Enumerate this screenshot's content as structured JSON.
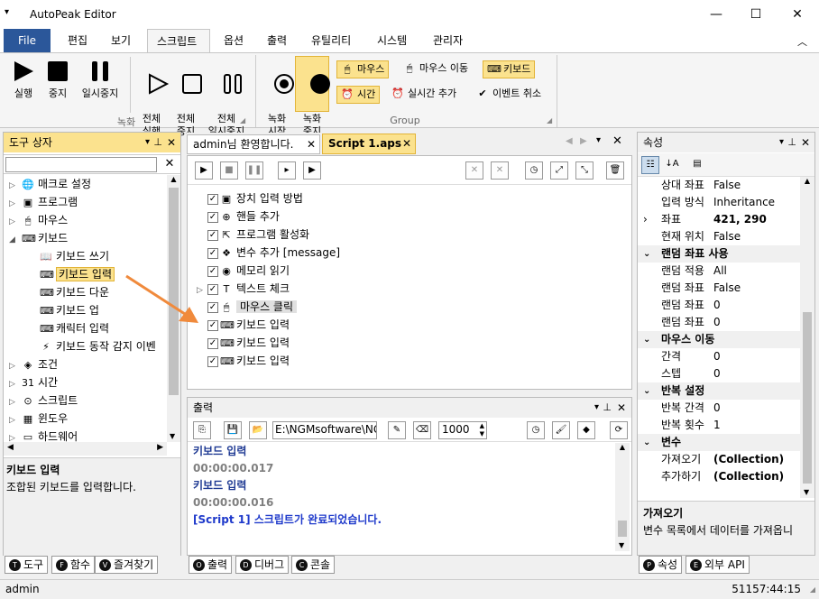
{
  "window": {
    "title": "AutoPeak Editor"
  },
  "ribbon_tabs": [
    "File",
    "편집",
    "보기",
    "스크립트",
    "옵션",
    "출력",
    "유틸리티",
    "시스템",
    "관리자"
  ],
  "record_group": {
    "label": "녹화",
    "buttons": [
      "실행",
      "중지",
      "일시중지",
      "전체\n실행",
      "전체\n중지",
      "전체\n일시중지"
    ]
  },
  "group2": {
    "label": "Group",
    "record_start": "녹화\n시작",
    "record_stop": "녹화\n중지",
    "mouse": "마우스",
    "mouse_move": "마우스 이동",
    "keyboard": "키보드",
    "time": "시간",
    "realtime_add": "실시간 추가",
    "event_cancel": "이벤트 취소"
  },
  "toolbox": {
    "title": "도구 상자",
    "items": [
      {
        "label": "매크로 설정",
        "level": 0,
        "arrow": "▷",
        "icon": "🌐"
      },
      {
        "label": "프로그램",
        "level": 0,
        "arrow": "▷",
        "icon": "▣"
      },
      {
        "label": "마우스",
        "level": 0,
        "arrow": "▷",
        "icon": "🖱"
      },
      {
        "label": "키보드",
        "level": 0,
        "arrow": "◢",
        "icon": "⌨"
      },
      {
        "label": "키보드 쓰기",
        "level": 1,
        "icon": "📖"
      },
      {
        "label": "키보드 입력",
        "level": 1,
        "icon": "⌨",
        "selected": true
      },
      {
        "label": "키보드 다운",
        "level": 1,
        "icon": "⌨"
      },
      {
        "label": "키보드 업",
        "level": 1,
        "icon": "⌨"
      },
      {
        "label": "캐릭터 입력",
        "level": 1,
        "icon": "⌨"
      },
      {
        "label": "키보드 동작 감지 이벤",
        "level": 1,
        "icon": "⚡"
      },
      {
        "label": "조건",
        "level": 0,
        "arrow": "▷",
        "icon": "◈"
      },
      {
        "label": "시간",
        "level": 0,
        "arrow": "▷",
        "icon": "31"
      },
      {
        "label": "스크립트",
        "level": 0,
        "arrow": "▷",
        "icon": "⊙"
      },
      {
        "label": "윈도우",
        "level": 0,
        "arrow": "▷",
        "icon": "▦"
      },
      {
        "label": "하드웨어",
        "level": 0,
        "arrow": "▷",
        "icon": "▭"
      }
    ],
    "desc_title": "키보드 입력",
    "desc_text": "조합된 키보드를 입력합니다."
  },
  "left_tabs": [
    "도구",
    "함수",
    "즐겨찾기"
  ],
  "doc_tabs": [
    "admin님 환영합니다.",
    "Script 1.aps"
  ],
  "script_items": [
    {
      "label": "장치 입력 방법",
      "icon": "▣"
    },
    {
      "label": "핸들 추가",
      "icon": "⊕"
    },
    {
      "label": "프로그램 활성화",
      "icon": "⇱"
    },
    {
      "label": "변수 추가 [message]",
      "icon": "❖"
    },
    {
      "label": "메모리 읽기",
      "icon": "◉"
    },
    {
      "label": "텍스트 체크",
      "icon": "T",
      "arrow": "▷"
    },
    {
      "label": "마우스 클릭",
      "icon": "🖱",
      "selected": true
    },
    {
      "label": "키보드 입력",
      "icon": "⌨"
    },
    {
      "label": "키보드 입력",
      "icon": "⌨"
    },
    {
      "label": "키보드 입력",
      "icon": "⌨"
    }
  ],
  "output": {
    "title": "출력",
    "path": "E:\\NGMsoftware\\NG",
    "number": "1000",
    "lines": [
      {
        "text": "키보드 입력",
        "color": "#1f3a93",
        "bold": true
      },
      {
        "text": "00:00:00.017",
        "color": "#808080",
        "bold": true
      },
      {
        "text": "키보드 입력",
        "color": "#1f3a93",
        "bold": true
      },
      {
        "text": "00:00:00.016",
        "color": "#808080",
        "bold": true
      },
      {
        "text": "[Script 1] 스크립트가 완료되었습니다.",
        "color": "#1f3acb",
        "bold": true
      }
    ]
  },
  "bottom_tabs": [
    "출력",
    "디버그",
    "콘솔"
  ],
  "properties": {
    "title": "속성",
    "rows": [
      {
        "k": "상대 좌표",
        "v": "False"
      },
      {
        "k": "입력 방식",
        "v": "Inheritance"
      },
      {
        "k": "좌표",
        "v": "421, 290",
        "bold": true,
        "arrow": "›"
      },
      {
        "k": "현재 위치",
        "v": "False"
      },
      {
        "cat": "랜덤 좌표 사용"
      },
      {
        "k": "랜덤 적용",
        "v": "All"
      },
      {
        "k": "랜덤 좌표",
        "v": "False"
      },
      {
        "k": "랜덤 좌표",
        "v": "0"
      },
      {
        "k": "랜덤 좌표",
        "v": "0"
      },
      {
        "cat": "마우스 이동"
      },
      {
        "k": "간격",
        "v": "0"
      },
      {
        "k": "스텝",
        "v": "0"
      },
      {
        "cat": "반복 설정"
      },
      {
        "k": "반복 간격",
        "v": "0"
      },
      {
        "k": "반복 횟수",
        "v": "1"
      },
      {
        "cat": "변수"
      },
      {
        "k": "가져오기",
        "v": "(Collection)",
        "bold": true
      },
      {
        "k": "추가하기",
        "v": "(Collection)",
        "bold": true
      }
    ],
    "desc_title": "가져오기",
    "desc_text": "변수 목록에서 데이터를 가져옵니"
  },
  "right_tabs": [
    "속성",
    "외부 API"
  ],
  "status": {
    "user": "admin",
    "time": "51157:44:15"
  }
}
